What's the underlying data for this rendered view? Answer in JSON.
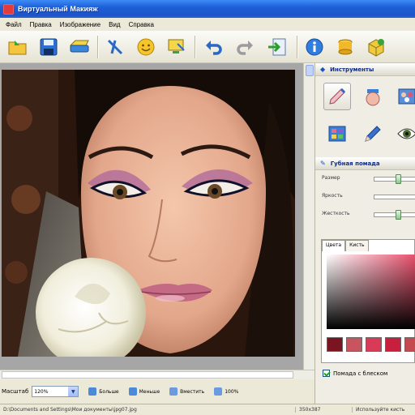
{
  "window": {
    "title": "Виртуальный Макияж"
  },
  "menu": [
    "Файл",
    "Правка",
    "Изображение",
    "Вид",
    "Справка"
  ],
  "toolbar": {
    "buttons": [
      "open-folder-icon",
      "save-icon",
      "scanner-icon",
      "crop-icon",
      "smiley-icon",
      "display-icon",
      "undo-icon",
      "redo-icon",
      "export-icon",
      "info-icon",
      "coins-icon",
      "package-icon"
    ]
  },
  "panel": {
    "tools_title": "Инструменты",
    "tool_icons": [
      "brush-icon",
      "jar-icon",
      "palette-icon",
      "eyeshadow-icon",
      "pencil-icon",
      "eye-icon"
    ],
    "tool_title": "Губная помада",
    "sliders": [
      {
        "label": "Размер",
        "value": 0.62
      },
      {
        "label": "Яркость",
        "value": 0.0
      },
      {
        "label": "Жесткость",
        "value": 0.62
      }
    ],
    "tabs": [
      "Цвета",
      "Кисть"
    ],
    "swatches": [
      "#7a1420",
      "#c8545e",
      "#d93a55",
      "#c81f3c",
      "#c54a4f"
    ],
    "gloss_label": "Помада с блеском",
    "colors": {
      "accent": "#e8506c"
    }
  },
  "zoom": {
    "label": "Масштаб",
    "value": "120%",
    "buttons": [
      "Больше",
      "Меньше",
      "Вместить",
      "100%"
    ]
  },
  "status": {
    "path": "D:\\Documents and Settings\\Мои документы\\jpg07.jpg",
    "size": "350х387",
    "hint": "Используйте кисть"
  }
}
